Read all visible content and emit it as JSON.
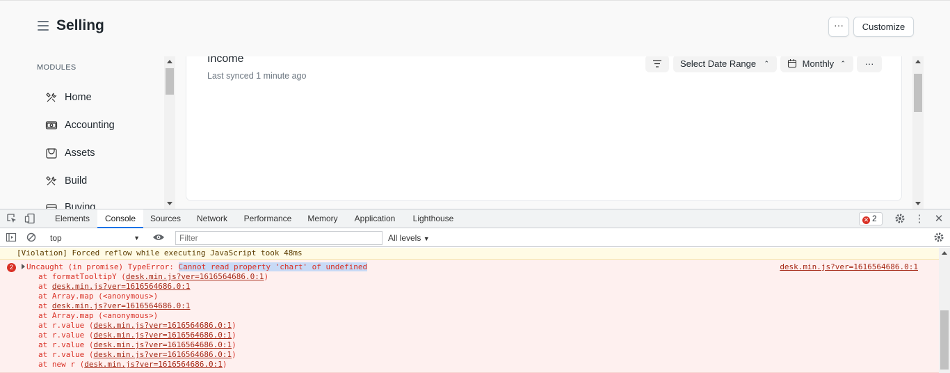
{
  "header": {
    "title": "Selling",
    "more_label": "···",
    "customize_label": "Customize"
  },
  "sidebar": {
    "section_label": "MODULES",
    "items": [
      {
        "label": "Home",
        "icon": "tools-icon"
      },
      {
        "label": "Accounting",
        "icon": "money-icon"
      },
      {
        "label": "Assets",
        "icon": "assets-icon"
      },
      {
        "label": "Build",
        "icon": "build-icon"
      },
      {
        "label": "Buying",
        "icon": "buying-icon"
      }
    ]
  },
  "card": {
    "title": "Income",
    "subtitle": "Last synced 1 minute ago",
    "date_range_label": "Select Date Range",
    "period_label": "Monthly",
    "more_label": "···"
  },
  "devtools": {
    "tabs": [
      "Elements",
      "Console",
      "Sources",
      "Network",
      "Performance",
      "Memory",
      "Application",
      "Lighthouse"
    ],
    "active_tab": "Console",
    "error_count": "2",
    "context": "top",
    "filter_placeholder": "Filter",
    "levels_label": "All levels"
  },
  "console": {
    "violation": "[Violation] Forced reflow while executing JavaScript took 48ms",
    "error_badge": "2",
    "error_prefix": "Uncaught (in promise) TypeError: ",
    "error_message": "Cannot read property 'chart' of undefined",
    "error_source": "desk.min.js?ver=1616564686.0:1",
    "stack": [
      {
        "prefix": "at formatTooltipY (",
        "link": "desk.min.js?ver=1616564686.0:1",
        "suffix": ")"
      },
      {
        "prefix": "at ",
        "link": "desk.min.js?ver=1616564686.0:1",
        "suffix": ""
      },
      {
        "prefix": "at Array.map (<anonymous>)",
        "link": "",
        "suffix": ""
      },
      {
        "prefix": "at ",
        "link": "desk.min.js?ver=1616564686.0:1",
        "suffix": ""
      },
      {
        "prefix": "at Array.map (<anonymous>)",
        "link": "",
        "suffix": ""
      },
      {
        "prefix": "at r.value (",
        "link": "desk.min.js?ver=1616564686.0:1",
        "suffix": ")"
      },
      {
        "prefix": "at r.value (",
        "link": "desk.min.js?ver=1616564686.0:1",
        "suffix": ")"
      },
      {
        "prefix": "at r.value (",
        "link": "desk.min.js?ver=1616564686.0:1",
        "suffix": ")"
      },
      {
        "prefix": "at r.value (",
        "link": "desk.min.js?ver=1616564686.0:1",
        "suffix": ")"
      },
      {
        "prefix": "at new r (",
        "link": "desk.min.js?ver=1616564686.0:1",
        "suffix": ")"
      }
    ]
  },
  "colors": {
    "error_red": "#d93025",
    "error_bg": "#fef0ef",
    "violation_bg": "#fffbe5",
    "active_tab_accent": "#1a73e8"
  }
}
